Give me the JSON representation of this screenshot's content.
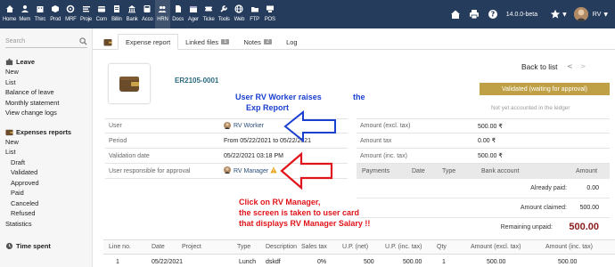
{
  "topmenu": [
    {
      "label": "Home",
      "icon": "home-icon"
    },
    {
      "label": "Mem",
      "icon": "members-icon"
    },
    {
      "label": "Thirc",
      "icon": "thirdparty-icon"
    },
    {
      "label": "Prod",
      "icon": "product-icon"
    },
    {
      "label": "MRF",
      "icon": "mrf-icon"
    },
    {
      "label": "Proje",
      "icon": "project-icon"
    },
    {
      "label": "Com",
      "icon": "commerce-icon"
    },
    {
      "label": "Billin",
      "icon": "billing-icon"
    },
    {
      "label": "Bank",
      "icon": "bank-icon"
    },
    {
      "label": "Acco",
      "icon": "accounting-icon"
    },
    {
      "label": "HRN",
      "icon": "hrm-icon"
    },
    {
      "label": "Docs",
      "icon": "documents-icon"
    },
    {
      "label": "Ager",
      "icon": "agenda-icon"
    },
    {
      "label": "Ticke",
      "icon": "ticket-icon"
    },
    {
      "label": "Tools",
      "icon": "tools-icon"
    },
    {
      "label": "Web",
      "icon": "web-icon"
    },
    {
      "label": "FTP",
      "icon": "ftp-icon"
    },
    {
      "label": "POS",
      "icon": "pos-icon"
    }
  ],
  "topright": {
    "version": "14.0.0-beta",
    "user": "RV"
  },
  "sidebar": {
    "search_placeholder": "Search",
    "leave_title": "Leave",
    "leave_items": [
      "New",
      "List",
      "Balance of leave",
      "Monthly statement",
      "View change logs"
    ],
    "expense_title": "Expenses reports",
    "expense_items": [
      "New",
      "List"
    ],
    "expense_subitems": [
      "Draft",
      "Validated",
      "Approved",
      "Paid",
      "Canceled",
      "Refused"
    ],
    "expense_after": "Statistics",
    "time_title": "Time spent"
  },
  "tabs": [
    {
      "label": "Expense report",
      "badge": ""
    },
    {
      "label": "Linked files",
      "badge": "1"
    },
    {
      "label": "Notes",
      "badge": "2"
    },
    {
      "label": "Log",
      "badge": ""
    }
  ],
  "header": {
    "ref": "ER2105-0001",
    "back_to_list": "Back to list",
    "status": "Validated (waiting for approval)",
    "ledger_note": "Not yet accounted in the ledger"
  },
  "fields": [
    {
      "label": "User",
      "value": "RV Worker",
      "link": true
    },
    {
      "label": "Period",
      "value": "From 05/22/2021 to 05/22/2021",
      "link": false
    },
    {
      "label": "Validation date",
      "value": "05/22/2021 03:18 PM",
      "link": false
    },
    {
      "label": "User responsible for approval",
      "value": "RV Manager",
      "link": true
    }
  ],
  "amounts": [
    {
      "label": "Amount (excl. tax)",
      "value": "500.00 ₹"
    },
    {
      "label": "Amount tax",
      "value": "0.00 ₹"
    },
    {
      "label": "Amount (inc. tax)",
      "value": "500.00 ₹"
    }
  ],
  "payments": {
    "headers": [
      "Payments",
      "Date",
      "Type",
      "Bank account",
      "Amount"
    ],
    "already_paid_label": "Already paid:",
    "already_paid": "0.00",
    "claimed_label": "Amount claimed:",
    "claimed": "500.00",
    "remaining_label": "Remaining unpaid:",
    "remaining": "500.00"
  },
  "annotations": {
    "blue_line1": "User RV Worker raises",
    "blue_the": "the",
    "blue_line2": "Exp Report",
    "red_line1": "Click on RV Manager,",
    "red_line2": "the screen is taken to user card",
    "red_line3": "that displays RV Manager Salary !!"
  },
  "lines": {
    "headers": [
      "Line no.",
      "Date",
      "Project",
      "Type",
      "Description",
      "Sales tax",
      "U.P. (net)",
      "U.P. (inc. tax)",
      "Qty",
      "Amount (excl. tax)",
      "Amount (inc. tax)"
    ],
    "rows": [
      [
        "1",
        "05/22/2021",
        "",
        "Lunch",
        "dskdf",
        "0%",
        "500",
        "500.00",
        "1",
        "500.00",
        "500.00"
      ]
    ]
  },
  "colors": {
    "topbar": "#263c5c",
    "status": "#bfa046",
    "ref": "#2a6a7e",
    "remaining": "#8b1b1b",
    "annotation_blue": "#1a3fd1",
    "annotation_red": "#e0141a"
  }
}
